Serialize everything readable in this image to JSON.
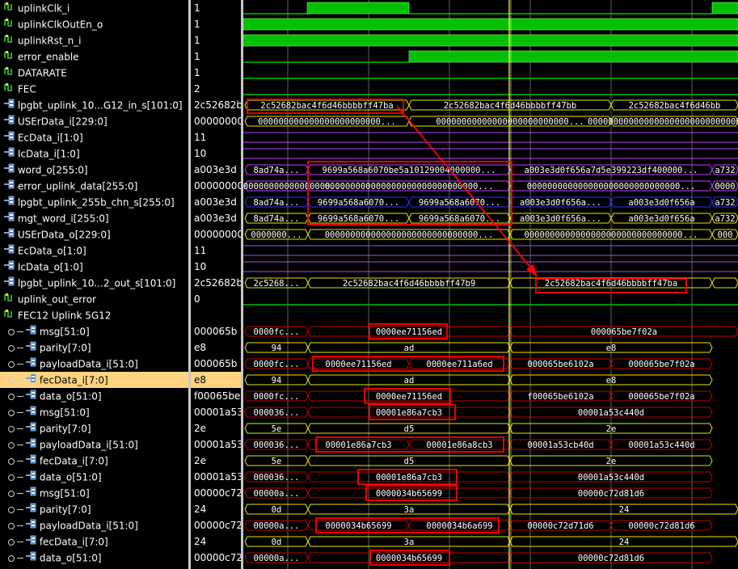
{
  "rows": [
    {
      "name": "uplinkClk_i",
      "value": "1",
      "kind": "bit",
      "indent": 0
    },
    {
      "name": "uplinkClkOutEn_o",
      "value": "1",
      "kind": "bit",
      "indent": 0
    },
    {
      "name": "uplinkRst_n_i",
      "value": "1",
      "kind": "bit",
      "indent": 0
    },
    {
      "name": "error_enable",
      "value": "1",
      "kind": "bit",
      "indent": 0
    },
    {
      "name": "DATARATE",
      "value": "1",
      "kind": "bit",
      "indent": 0
    },
    {
      "name": "FEC",
      "value": "2",
      "kind": "bit",
      "indent": 0
    },
    {
      "name": "lpgbt_uplink_10...G12_in_s[101:0]",
      "value": "2c52682b",
      "kind": "bus",
      "indent": 0
    },
    {
      "name": "USErData_i[229:0]",
      "value": "00000000",
      "kind": "bus",
      "indent": 0
    },
    {
      "name": "EcData_i[1:0]",
      "value": "11",
      "kind": "bus",
      "indent": 0
    },
    {
      "name": "IcData_i[1:0]",
      "value": "10",
      "kind": "bus",
      "indent": 0
    },
    {
      "name": "word_o[255:0]",
      "value": "a003e3d",
      "kind": "bus",
      "indent": 0
    },
    {
      "name": "error_uplink_data[255:0]",
      "value": "00000000",
      "kind": "bus",
      "indent": 0
    },
    {
      "name": "lpgbt_uplink_255b_chn_s[255:0]",
      "value": "a003e3d",
      "kind": "bus",
      "indent": 0
    },
    {
      "name": "mgt_word_i[255:0]",
      "value": "a003e3d",
      "kind": "bus",
      "indent": 0
    },
    {
      "name": "USErData_o[229:0]",
      "value": "00000000",
      "kind": "bus",
      "indent": 0
    },
    {
      "name": "EcData_o[1:0]",
      "value": "11",
      "kind": "bus",
      "indent": 0
    },
    {
      "name": "IcData_o[1:0]",
      "value": "10",
      "kind": "bus",
      "indent": 0
    },
    {
      "name": "lpgbt_uplink_10...2_out_s[101:0]",
      "value": "2c52682b",
      "kind": "bus",
      "indent": 0
    },
    {
      "name": "uplink_out_error",
      "value": "0",
      "kind": "bit",
      "indent": 0
    },
    {
      "name": "FEC12 Uplink 5G12",
      "value": "",
      "kind": "group",
      "indent": 0
    },
    {
      "name": "msg[51:0]",
      "value": "000065b",
      "kind": "bus",
      "indent": 1
    },
    {
      "name": "parity[7:0]",
      "value": "e8",
      "kind": "bus",
      "indent": 1
    },
    {
      "name": "payloadData_i[51:0]",
      "value": "000065b",
      "kind": "bus",
      "indent": 1
    },
    {
      "name": "fecData_i[7:0]",
      "value": "e8",
      "kind": "bus",
      "indent": 1,
      "selected": true
    },
    {
      "name": "data_o[51:0]",
      "value": "f00065be",
      "kind": "bus",
      "indent": 1
    },
    {
      "name": "msg[51:0]",
      "value": "00001a53",
      "kind": "bus",
      "indent": 1
    },
    {
      "name": "parity[7:0]",
      "value": "2e",
      "kind": "bus",
      "indent": 1
    },
    {
      "name": "payloadData_i[51:0]",
      "value": "00001a53",
      "kind": "bus",
      "indent": 1
    },
    {
      "name": "fecData_i[7:0]",
      "value": "2e",
      "kind": "bus",
      "indent": 1
    },
    {
      "name": "data_o[51:0]",
      "value": "00001a53",
      "kind": "bus",
      "indent": 1
    },
    {
      "name": "msg[51:0]",
      "value": "00000c72",
      "kind": "bus",
      "indent": 1
    },
    {
      "name": "parity[7:0]",
      "value": "24",
      "kind": "bus",
      "indent": 1
    },
    {
      "name": "payloadData_i[51:0]",
      "value": "00000c72",
      "kind": "bus",
      "indent": 1
    },
    {
      "name": "fecData_i[7:0]",
      "value": "24",
      "kind": "bus",
      "indent": 1
    },
    {
      "name": "data_o[51:0]",
      "value": "00000c72",
      "kind": "bus",
      "indent": 1
    }
  ],
  "bus_labels": {
    "r6": [
      "2c52682bac4f6d46bbbbff47ba",
      "2c52682bac4f6d46bbbbff47bb",
      "2c52682bac4f6d46bb"
    ],
    "r7": [
      "000000000000000000000000...",
      "00000000000000000000000000...",
      "0000000000000000000000000000000..."
    ],
    "r10": [
      "8ad74a...",
      "9699a568a6070be5a10129004000000...",
      "a003e3d0f656a7d5e399223df400000...",
      "a732"
    ],
    "r11": [
      "000000000000000000000000...",
      "000000000000000000000000000000...",
      "000000000000000000000000000000...",
      "0000"
    ],
    "r12": [
      "8ad74a...",
      "9699a568a6070...",
      "9699a568a6070...",
      "a003e3d0f656a...",
      "a003e3d0f656a",
      "a732"
    ],
    "r13": [
      "8ad74a...",
      "9699a568a6070...",
      "9699a568a6070...",
      "a003e3d0f656a...",
      "a003e3d0f656a",
      "a732"
    ],
    "r14": [
      "0000000...",
      "000000000000000000000000000000...",
      "0000000000000000000000000000000...",
      "000"
    ],
    "r17": [
      "2c5268...",
      "2c52682bac4f6d46bbbbff47b9",
      "2c52682bac4f6d46bbbbff47ba"
    ],
    "r20": [
      "0000fc...",
      "0000ee71156ed",
      "000065be7f02a"
    ],
    "r21": [
      "94",
      "ad",
      "e8"
    ],
    "r22": [
      "0000fc...",
      "0000ee71156ed",
      "0000ee711a6ed",
      "000065be6102a",
      "000065be7f02a"
    ],
    "r23": [
      "94",
      "ad",
      "e8"
    ],
    "r24": [
      "0000fc...",
      "0000ee71156ed",
      "f00065be6102a",
      "000065be7f02a"
    ],
    "r25": [
      "000036...",
      "00001e86a7cb3",
      "00001a53c440d"
    ],
    "r26": [
      "5e",
      "d5",
      "2e"
    ],
    "r27": [
      "000036...",
      "00001e86a7cb3",
      "00001e86a8cb3",
      "00001a53cb40d",
      "00001a53c440d"
    ],
    "r28": [
      "5e",
      "d5",
      "2e"
    ],
    "r29": [
      "000036...",
      "00001e86a7cb3",
      "00001a53c440d"
    ],
    "r30": [
      "00000a...",
      "0000034b65699",
      "00000c72d81d6"
    ],
    "r31": [
      "0d",
      "3a",
      "24"
    ],
    "r32": [
      "00000a...",
      "0000034b65699",
      "0000034b6a699",
      "00000c72d71d6",
      "00000c72d81d6"
    ],
    "r33": [
      "0d",
      "3a",
      "24"
    ],
    "r34": [
      "00000a...",
      "0000034b65699",
      "00000c72d81d6"
    ]
  },
  "colors": {
    "signal_green": "#00c000",
    "bus_outline": "#e6e600",
    "bus_text": "#ffffff",
    "selection": "#ffd37f",
    "highlight_box": "#ff0000",
    "cursor": "#ffff66",
    "grid": "#8c8c8c"
  },
  "icons": {
    "bit": "logic-signal-icon",
    "bus": "bus-signal-icon",
    "group": "group-icon"
  }
}
